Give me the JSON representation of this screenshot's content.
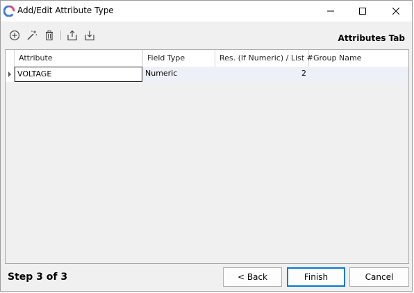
{
  "window": {
    "title": "Add/Edit Attribute Type"
  },
  "toolbar": {
    "icons": [
      "add-icon",
      "magic-wand-icon",
      "trash-icon",
      "export-icon",
      "import-icon"
    ],
    "tab_title": "Attributes Tab"
  },
  "grid": {
    "columns": [
      "Attribute",
      "Field Type",
      "Res. (If Numeric) / List #",
      "Group Name"
    ],
    "rows": [
      {
        "attribute": "VOLTAGE",
        "field_type": "Numeric",
        "res": "2",
        "group": ""
      }
    ]
  },
  "footer": {
    "step": "Step 3 of 3",
    "back": "< Back",
    "finish": "Finish",
    "cancel": "Cancel"
  },
  "colors": {
    "accent": "#0078d7",
    "row_bg": "#eef0f8"
  }
}
